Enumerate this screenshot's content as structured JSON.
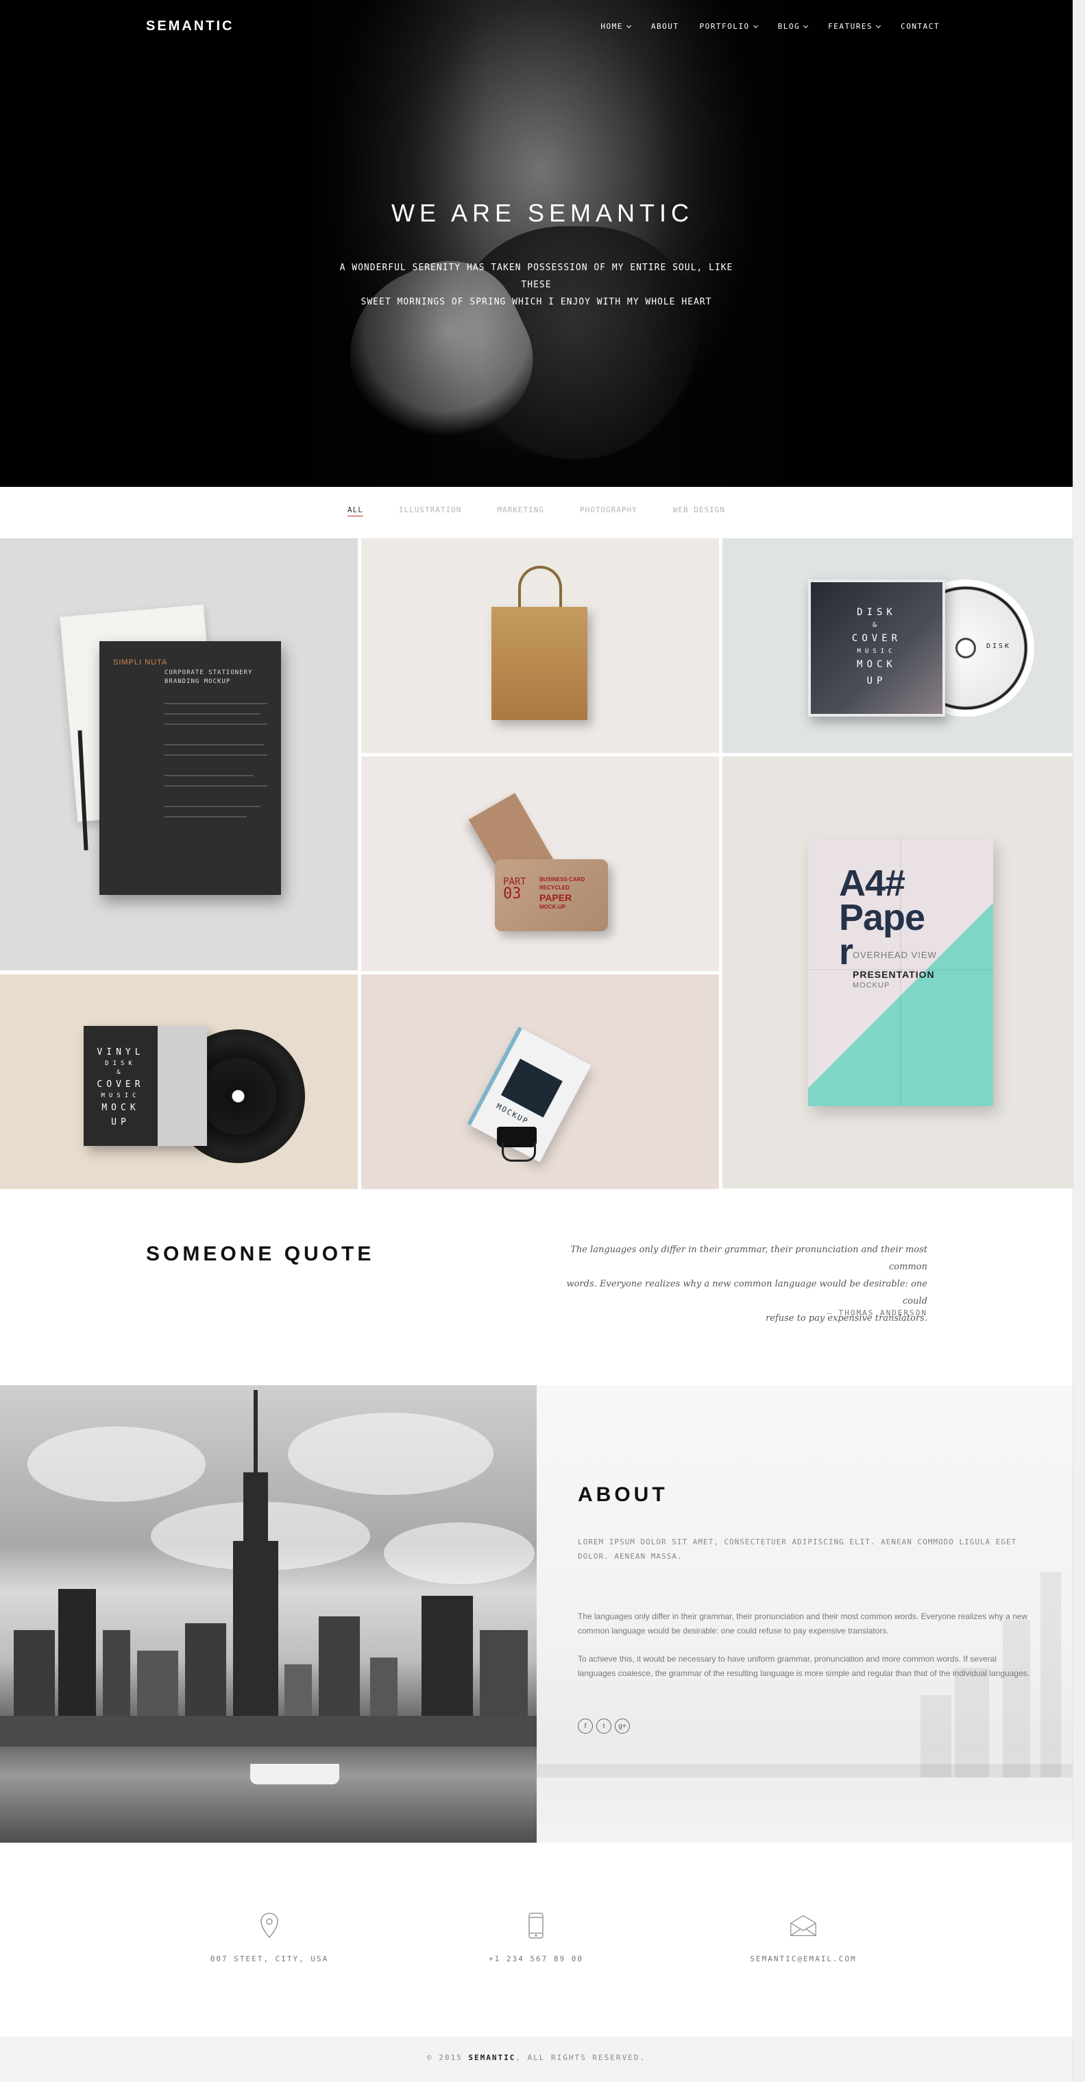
{
  "header": {
    "logo": "SEMANTIC",
    "nav": [
      {
        "label": "HOME",
        "dropdown": true
      },
      {
        "label": "ABOUT",
        "dropdown": false
      },
      {
        "label": "PORTFOLIO",
        "dropdown": true
      },
      {
        "label": "BLOG",
        "dropdown": true
      },
      {
        "label": "FEATURES",
        "dropdown": true
      },
      {
        "label": "CONTACT",
        "dropdown": false
      }
    ]
  },
  "hero": {
    "title": "WE ARE SEMANTIC",
    "subtitle_line1": "A WONDERFUL SERENITY HAS TAKEN POSSESSION OF MY ENTIRE SOUL, LIKE THESE",
    "subtitle_line2": "SWEET MORNINGS OF SPRING WHICH I ENJOY WITH MY WHOLE HEART"
  },
  "portfolio": {
    "filters": [
      "ALL",
      "ILLUSTRATION",
      "MARKETING",
      "PHOTOGRAPHY",
      "WEB DESIGN"
    ],
    "active_filter": "ALL",
    "tiles": {
      "stationery": {
        "brand": "SIMPLI NUTA",
        "heading_line1": "CORPORATE STATIONERY",
        "heading_line2": "BRANDING MOCKUP"
      },
      "disk": {
        "cover_lines": [
          "DISK",
          "&",
          "COVER",
          "MUSIC",
          "MOCK",
          "UP"
        ],
        "disc_label": "DISK"
      },
      "business_card": {
        "part_line1": "PART",
        "part_line2": "03",
        "lines": [
          "BUSINESS CARD",
          "RECYCLED",
          "PAPER",
          "MOCK-UP"
        ]
      },
      "a4": {
        "big_line1": "A4#",
        "big_line2": "Pape",
        "big_line3": "r",
        "overhead": "OVERHEAD VIEW",
        "presentation": "PRESENTATION",
        "mockup": "MOCKUP"
      },
      "vinyl": {
        "cover_lines": [
          "VINYL",
          "DISK",
          "&",
          "COVER",
          "MUSIC",
          "MOCK",
          "UP"
        ]
      },
      "card_stand": {
        "label": "MOCKUP"
      }
    }
  },
  "quote": {
    "title": "SOMEONE QUOTE",
    "text_line1": "The languages only differ in their grammar, their pronunciation and their most common",
    "text_line2": "words. Everyone realizes why a new common language would be desirable: one could",
    "text_line3": "refuse to pay expensive translators.",
    "author": "— THOMAS ANDERSON"
  },
  "about": {
    "title": "ABOUT",
    "lead": "LOREM IPSUM DOLOR SIT AMET, CONSECTETUER ADIPISCING ELIT. AENEAN COMMODO LIGULA EGET DOLOR. AENEAN MASSA.",
    "paragraph1": "The languages only differ in their grammar, their pronunciation and their most common words. Everyone realizes why a new common language would be desirable: one could refuse to pay expensive translators.",
    "paragraph2": "To achieve this, it would be necessary to have uniform grammar, pronunciation and more common words. If several languages coalesce, the grammar of the resulting language is more simple and regular than that of the individual languages.",
    "socials": [
      {
        "icon": "facebook-icon",
        "glyph": "f"
      },
      {
        "icon": "twitter-icon",
        "glyph": "t"
      },
      {
        "icon": "google-plus-icon",
        "glyph": "g+"
      }
    ]
  },
  "contact": {
    "address": "007 STEET, CITY, USA",
    "phone": "+1 234 567 89 00",
    "email": "SEMANTIC@EMAIL.COM"
  },
  "footer": {
    "prefix": "© 2015 ",
    "brand": "SEMANTIC",
    "suffix": ", ALL RIGHTS RESERVED."
  },
  "colors": {
    "hero_bg": "#000000",
    "filter_active_underline": "#aa3333",
    "footer_bg": "#f3f3f3",
    "a4_accent": "#7fd6c6"
  }
}
